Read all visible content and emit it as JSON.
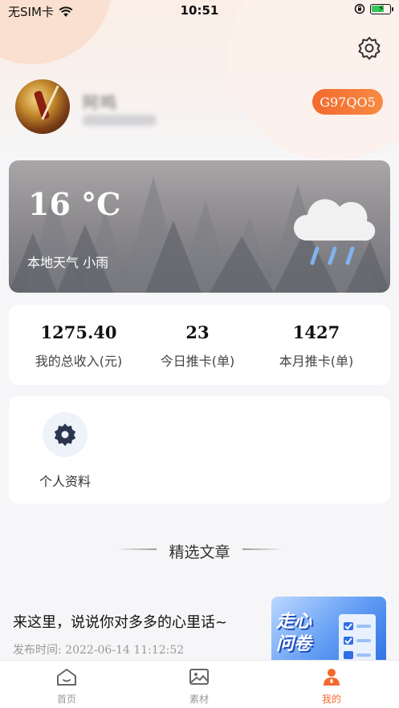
{
  "status_bar": {
    "carrier": "无SIM卡",
    "time": "10:51"
  },
  "profile": {
    "name": "阿鸣",
    "code": "G97QO5"
  },
  "weather": {
    "temperature": "16 °C",
    "description": "本地天气 小雨",
    "icon": "rain-cloud-icon"
  },
  "stats": [
    {
      "value": "1275.40",
      "label": "我的总收入(元)"
    },
    {
      "value": "23",
      "label": "今日推卡(单)"
    },
    {
      "value": "1427",
      "label": "本月推卡(单)"
    }
  ],
  "menu": {
    "items": [
      {
        "label": "个人资料",
        "icon": "gear-icon"
      }
    ]
  },
  "section": {
    "title": "精选文章"
  },
  "article": {
    "title": "来这里，说说你对多多的心里话~",
    "published": "发布时间: 2022-06-14 11:12:52",
    "thumb_text_line1": "走心",
    "thumb_text_line2": "问卷"
  },
  "tabs": [
    {
      "label": "首页",
      "icon": "home-icon",
      "active": false
    },
    {
      "label": "素材",
      "icon": "image-icon",
      "active": false
    },
    {
      "label": "我的",
      "icon": "user-icon",
      "active": true
    }
  ],
  "colors": {
    "accent": "#f26a2d",
    "icon_dark": "#2c3550"
  }
}
